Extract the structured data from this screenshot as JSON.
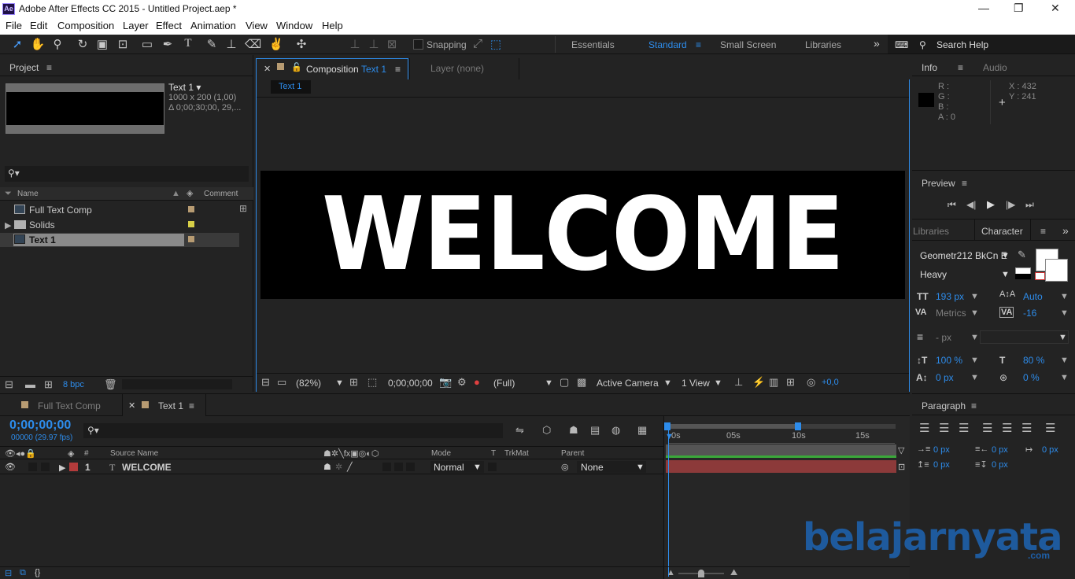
{
  "app": {
    "title": "Adobe After Effects CC 2015 - Untitled Project.aep *",
    "icon_text": "Ae",
    "window_buttons": {
      "minimize": "—",
      "restore": "❐",
      "close": "✕"
    }
  },
  "menu": [
    "File",
    "Edit",
    "Composition",
    "Layer",
    "Effect",
    "Animation",
    "View",
    "Window",
    "Help"
  ],
  "toolbar": {
    "snapping_label": "Snapping",
    "workspaces": [
      "Essentials",
      "Standard",
      "Small Screen",
      "Libraries"
    ],
    "active_workspace": "Standard",
    "overflow": "»",
    "search_help_placeholder": "Search Help"
  },
  "project": {
    "tab": "Project",
    "menu_icon": "≡",
    "selected_name": "Text 1 ▾",
    "selected_dims": "1000 x 200 (1,00)",
    "selected_duration": "Δ 0;00;30;00, 29,...",
    "search_glyph": "⚲▾",
    "columns": {
      "name": "Name",
      "comment": "Comment"
    },
    "items": [
      {
        "name": "Full Text Comp",
        "type": "comp",
        "color": "#b79b72"
      },
      {
        "name": "Solids",
        "type": "folder",
        "color": "#d7cf47"
      },
      {
        "name": "Text 1",
        "type": "comp",
        "color": "#b79b72",
        "selected": true
      }
    ],
    "bpc": "8 bpc"
  },
  "composition": {
    "tab_label": "Composition",
    "tab_name": "Text 1",
    "layer_tab": "Layer (none)",
    "breadcrumb": "Text 1",
    "canvas_text": "WELCOME",
    "zoom": "(82%)",
    "timecode": "0;00;00;00",
    "resolution": "(Full)",
    "camera": "Active Camera",
    "views": "1 View",
    "exposure": "+0,0"
  },
  "info": {
    "tab": "Info",
    "audio_tab": "Audio",
    "r": "R :",
    "g": "G :",
    "b": "B :",
    "a": "A : 0",
    "x": "X : 432",
    "y": "Y : 241"
  },
  "preview": {
    "tab": "Preview",
    "menu_icon": "≡"
  },
  "character": {
    "libraries_tab": "Libraries",
    "tab": "Character",
    "overflow": "»",
    "font": "Geometr212 BkCn E",
    "style": "Heavy",
    "size": "193 px",
    "leading": "Auto",
    "kerning": "Metrics",
    "tracking": "-16",
    "stroke_width": "- px",
    "vscale": "100 %",
    "hscale": "80 %",
    "baseline": "0 px",
    "tsume": "0 %"
  },
  "paragraph": {
    "tab": "Paragraph",
    "indent_left": "0 px",
    "indent_right": "0 px",
    "indent_first": "0 px",
    "space_before": "0 px",
    "space_after": "0 px"
  },
  "timeline": {
    "tab1": "Full Text Comp",
    "tab2": "Text 1",
    "timecode": "0;00;00;00",
    "fps": "00000 (29.97 fps)",
    "columns": {
      "hash": "#",
      "source": "Source Name",
      "mode": "Mode",
      "t": "T",
      "trkmat": "TrkMat",
      "parent": "Parent"
    },
    "ruler": [
      "0s",
      "05s",
      "10s",
      "15s"
    ],
    "layers": [
      {
        "index": "1",
        "name": "WELCOME",
        "mode": "Normal",
        "parent": "None",
        "color": "#b33b3b"
      }
    ]
  },
  "watermark": {
    "text": "belajarnyata",
    "suffix": ".com"
  }
}
